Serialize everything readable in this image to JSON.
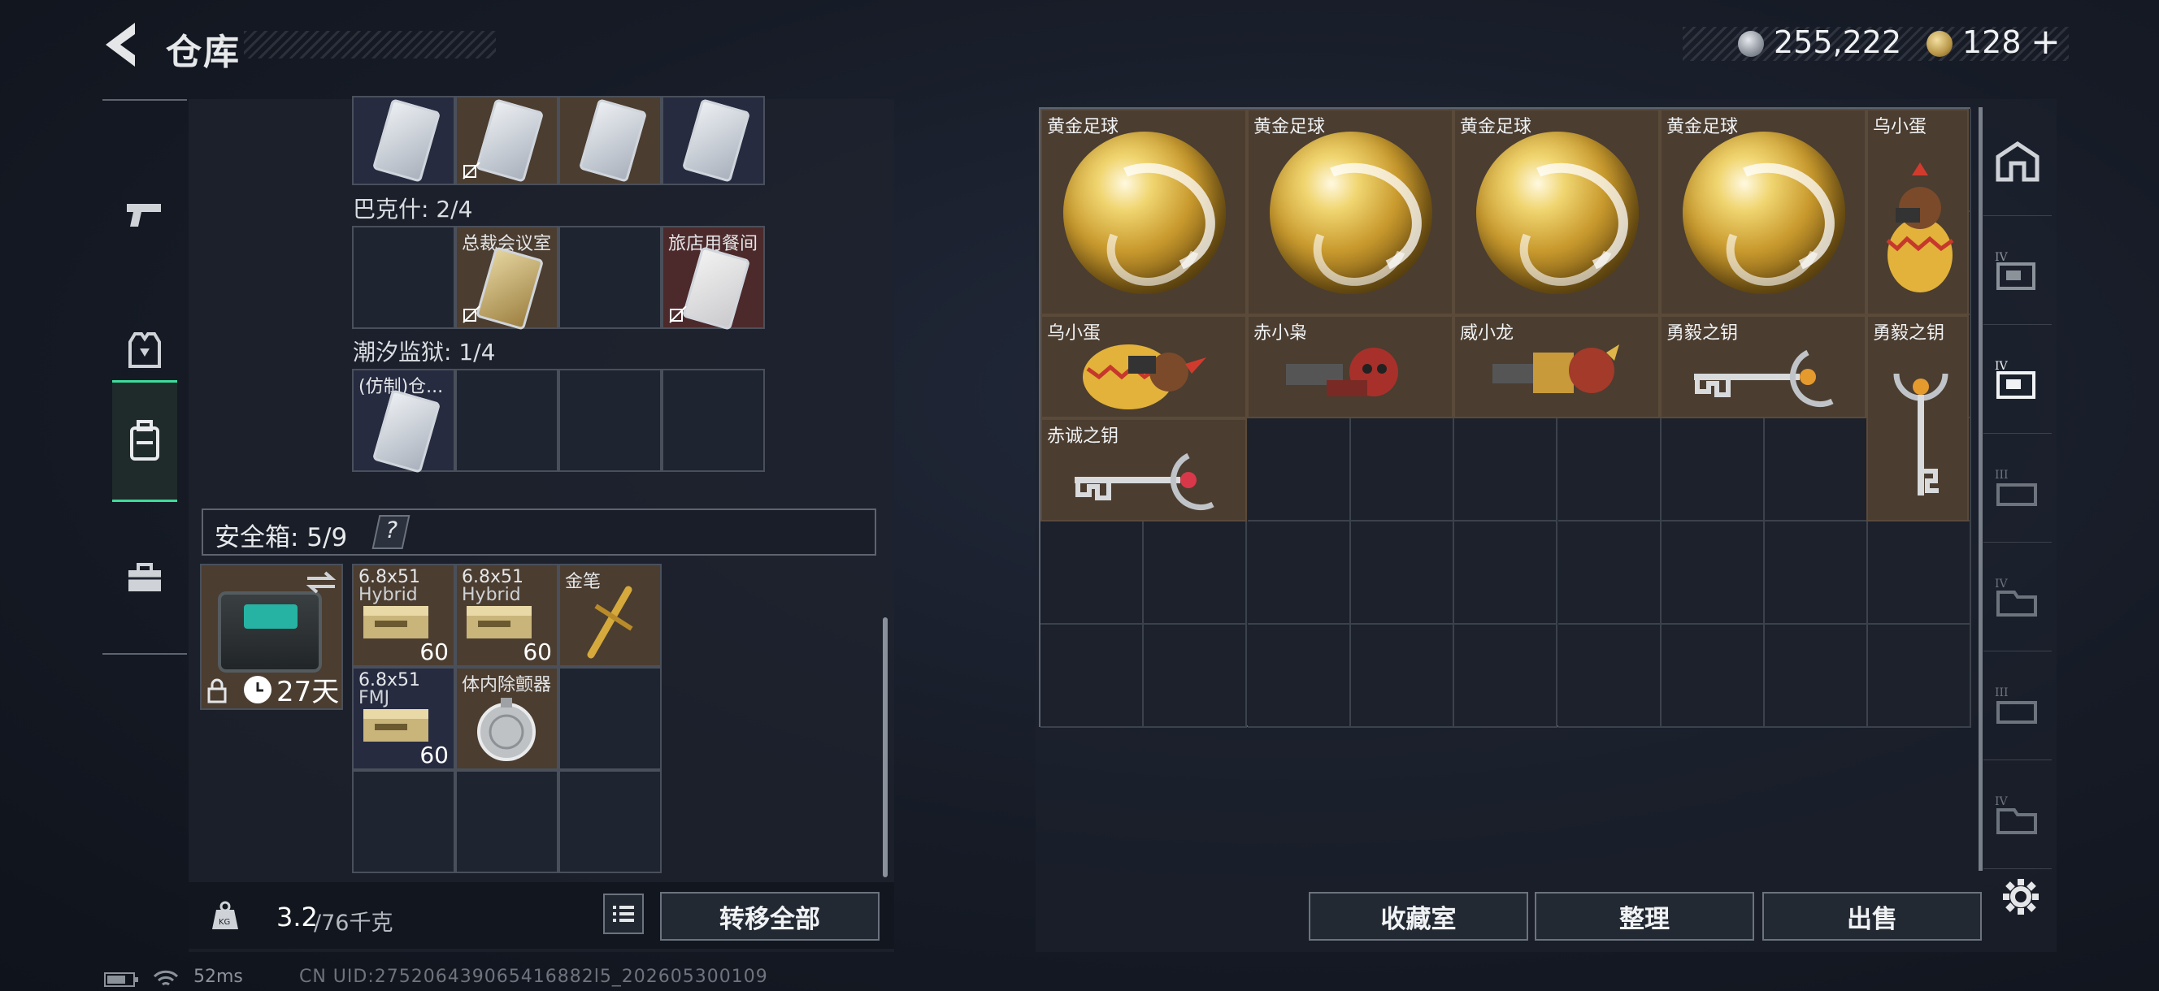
{
  "header": {
    "title": "仓库",
    "currency_silver": "255,222",
    "currency_gold": "128",
    "plus_label": "+"
  },
  "nav": {
    "items": [
      {
        "name": "weapons-tab",
        "icon": "pistol-icon"
      },
      {
        "name": "armor-tab",
        "icon": "armor-icon"
      },
      {
        "name": "backpack-tab",
        "icon": "backpack-icon",
        "selected": true
      },
      {
        "name": "case-tab",
        "icon": "briefcase-icon"
      }
    ]
  },
  "keycards": {
    "bakeshi": {
      "label": "巴克什: 2/4",
      "slots": [
        "",
        "总裁会议室",
        "",
        "旅店用餐间"
      ]
    },
    "chaoxi": {
      "label": "潮汐监狱: 1/4",
      "slots": [
        "(仿制)仓...",
        "",
        "",
        ""
      ]
    }
  },
  "safe": {
    "label": "安全箱: 5/9",
    "help": "?",
    "days": "27天",
    "items": [
      {
        "label": "6.8x51",
        "sub": "Hybrid",
        "count": "60"
      },
      {
        "label": "6.8x51",
        "sub": "Hybrid",
        "count": "60"
      },
      {
        "label": "金笔",
        "sub": "",
        "count": ""
      },
      {
        "label": "6.8x51",
        "sub": "FMJ",
        "count": "60"
      },
      {
        "label": "体内除颤器",
        "sub": "",
        "count": ""
      }
    ]
  },
  "bottom_left": {
    "weight": "3.2",
    "weight_max": "/76千克",
    "transfer_label": "转移全部"
  },
  "stash": {
    "items": [
      {
        "label": "黄金足球"
      },
      {
        "label": "黄金足球"
      },
      {
        "label": "黄金足球"
      },
      {
        "label": "黄金足球"
      },
      {
        "label": "乌小蛋"
      },
      {
        "label": "乌小蛋"
      },
      {
        "label": "赤小枭"
      },
      {
        "label": "威小龙"
      },
      {
        "label": "勇毅之钥"
      },
      {
        "label": "勇毅之钥"
      },
      {
        "label": "赤诚之钥"
      }
    ]
  },
  "right_tabs": [
    "home-icon",
    "tier-IV-case-icon",
    "tier-IV-case-icon",
    "tier-III-case-icon",
    "tier-IV-box-icon",
    "tier-III-box-icon",
    "tier-IV-box-icon"
  ],
  "bottom_right": {
    "collection_label": "收藏室",
    "sort_label": "整理",
    "sell_label": "出售"
  },
  "status_bar": {
    "ping": "52ms",
    "uid": "CN UID:275206439065416882l5_202605300109"
  },
  "colors": {
    "accent": "#3ddc9a",
    "slot_brown": "#4b3d30",
    "slot_red": "#4c2a2c"
  }
}
